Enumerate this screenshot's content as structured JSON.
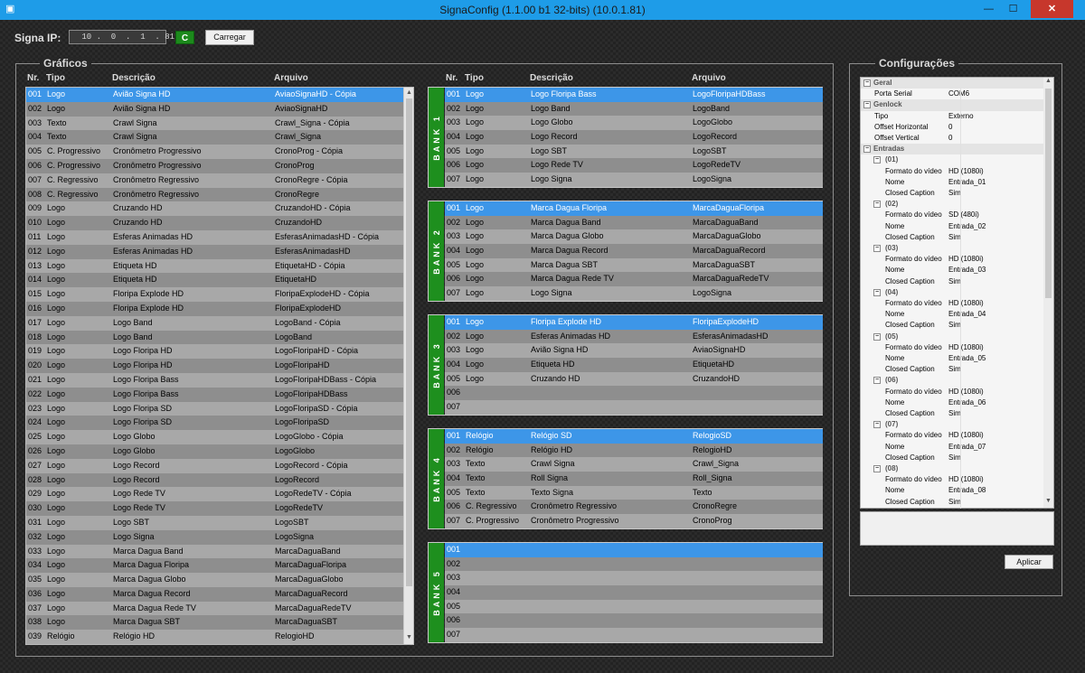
{
  "window": {
    "title": "SignaConfig (1.1.00 b1 32-bits)  (10.0.1.81)",
    "minimize_glyph": "—",
    "maximize_glyph": "☐",
    "close_glyph": "✕"
  },
  "toolbar": {
    "ip_label": "Signa IP:",
    "ip_value": " 10 .  0  .  1  . 81",
    "connect_label": "C",
    "load_label": "Carregar"
  },
  "graphics": {
    "title": "Gráficos",
    "headers": {
      "nr": "Nr.",
      "tipo": "Tipo",
      "descricao": "Descrição",
      "arquivo": "Arquivo"
    },
    "rows": [
      {
        "nr": "001",
        "tipo": "Logo",
        "desc": "Avião Signa HD",
        "file": "AviaoSignaHD - Cópia"
      },
      {
        "nr": "002",
        "tipo": "Logo",
        "desc": "Avião Signa HD",
        "file": "AviaoSignaHD"
      },
      {
        "nr": "003",
        "tipo": "Texto",
        "desc": "Crawl Signa",
        "file": "Crawl_Signa - Cópia"
      },
      {
        "nr": "004",
        "tipo": "Texto",
        "desc": "Crawl Signa",
        "file": "Crawl_Signa"
      },
      {
        "nr": "005",
        "tipo": "C. Progressivo",
        "desc": "Cronômetro Progressivo",
        "file": "CronoProg - Cópia"
      },
      {
        "nr": "006",
        "tipo": "C. Progressivo",
        "desc": "Cronômetro Progressivo",
        "file": "CronoProg"
      },
      {
        "nr": "007",
        "tipo": "C. Regressivo",
        "desc": "Cronômetro Regressivo",
        "file": "CronoRegre - Cópia"
      },
      {
        "nr": "008",
        "tipo": "C. Regressivo",
        "desc": "Cronômetro Regressivo",
        "file": "CronoRegre"
      },
      {
        "nr": "009",
        "tipo": "Logo",
        "desc": "Cruzando HD",
        "file": "CruzandoHD - Cópia"
      },
      {
        "nr": "010",
        "tipo": "Logo",
        "desc": "Cruzando HD",
        "file": "CruzandoHD"
      },
      {
        "nr": "011",
        "tipo": "Logo",
        "desc": "Esferas Animadas HD",
        "file": "EsferasAnimadasHD - Cópia"
      },
      {
        "nr": "012",
        "tipo": "Logo",
        "desc": "Esferas Animadas HD",
        "file": "EsferasAnimadasHD"
      },
      {
        "nr": "013",
        "tipo": "Logo",
        "desc": "Etiqueta HD",
        "file": "EtiquetaHD - Cópia"
      },
      {
        "nr": "014",
        "tipo": "Logo",
        "desc": "Etiqueta HD",
        "file": "EtiquetaHD"
      },
      {
        "nr": "015",
        "tipo": "Logo",
        "desc": "Floripa Explode HD",
        "file": "FloripaExplodeHD - Cópia"
      },
      {
        "nr": "016",
        "tipo": "Logo",
        "desc": "Floripa Explode HD",
        "file": "FloripaExplodeHD"
      },
      {
        "nr": "017",
        "tipo": "Logo",
        "desc": "Logo Band",
        "file": "LogoBand - Cópia"
      },
      {
        "nr": "018",
        "tipo": "Logo",
        "desc": "Logo Band",
        "file": "LogoBand"
      },
      {
        "nr": "019",
        "tipo": "Logo",
        "desc": "Logo Floripa HD",
        "file": "LogoFloripaHD - Cópia"
      },
      {
        "nr": "020",
        "tipo": "Logo",
        "desc": "Logo Floripa HD",
        "file": "LogoFloripaHD"
      },
      {
        "nr": "021",
        "tipo": "Logo",
        "desc": "Logo Floripa Bass",
        "file": "LogoFloripaHDBass - Cópia"
      },
      {
        "nr": "022",
        "tipo": "Logo",
        "desc": "Logo Floripa Bass",
        "file": "LogoFloripaHDBass"
      },
      {
        "nr": "023",
        "tipo": "Logo",
        "desc": "Logo Floripa SD",
        "file": "LogoFloripaSD - Cópia"
      },
      {
        "nr": "024",
        "tipo": "Logo",
        "desc": "Logo Floripa SD",
        "file": "LogoFloripaSD"
      },
      {
        "nr": "025",
        "tipo": "Logo",
        "desc": "Logo Globo",
        "file": "LogoGlobo - Cópia"
      },
      {
        "nr": "026",
        "tipo": "Logo",
        "desc": "Logo Globo",
        "file": "LogoGlobo"
      },
      {
        "nr": "027",
        "tipo": "Logo",
        "desc": "Logo Record",
        "file": "LogoRecord - Cópia"
      },
      {
        "nr": "028",
        "tipo": "Logo",
        "desc": "Logo Record",
        "file": "LogoRecord"
      },
      {
        "nr": "029",
        "tipo": "Logo",
        "desc": "Logo Rede TV",
        "file": "LogoRedeTV - Cópia"
      },
      {
        "nr": "030",
        "tipo": "Logo",
        "desc": "Logo Rede TV",
        "file": "LogoRedeTV"
      },
      {
        "nr": "031",
        "tipo": "Logo",
        "desc": "Logo SBT",
        "file": "LogoSBT"
      },
      {
        "nr": "032",
        "tipo": "Logo",
        "desc": "Logo Signa",
        "file": "LogoSigna"
      },
      {
        "nr": "033",
        "tipo": "Logo",
        "desc": "Marca Dagua Band",
        "file": "MarcaDaguaBand"
      },
      {
        "nr": "034",
        "tipo": "Logo",
        "desc": "Marca Dagua Floripa",
        "file": "MarcaDaguaFloripa"
      },
      {
        "nr": "035",
        "tipo": "Logo",
        "desc": "Marca Dagua Globo",
        "file": "MarcaDaguaGlobo"
      },
      {
        "nr": "036",
        "tipo": "Logo",
        "desc": "Marca Dagua Record",
        "file": "MarcaDaguaRecord"
      },
      {
        "nr": "037",
        "tipo": "Logo",
        "desc": "Marca Dagua Rede TV",
        "file": "MarcaDaguaRedeTV"
      },
      {
        "nr": "038",
        "tipo": "Logo",
        "desc": "Marca Dagua SBT",
        "file": "MarcaDaguaSBT"
      },
      {
        "nr": "039",
        "tipo": "Relógio",
        "desc": "Relógio HD",
        "file": "RelogioHD"
      }
    ]
  },
  "banks": {
    "headers": {
      "nr": "Nr.",
      "tipo": "Tipo",
      "descricao": "Descrição",
      "arquivo": "Arquivo"
    },
    "items": [
      {
        "label": "BANK 1",
        "rows": [
          {
            "nr": "001",
            "tipo": "Logo",
            "desc": "Logo Floripa Bass",
            "file": "LogoFloripaHDBass"
          },
          {
            "nr": "002",
            "tipo": "Logo",
            "desc": "Logo Band",
            "file": "LogoBand"
          },
          {
            "nr": "003",
            "tipo": "Logo",
            "desc": "Logo Globo",
            "file": "LogoGlobo"
          },
          {
            "nr": "004",
            "tipo": "Logo",
            "desc": "Logo Record",
            "file": "LogoRecord"
          },
          {
            "nr": "005",
            "tipo": "Logo",
            "desc": "Logo SBT",
            "file": "LogoSBT"
          },
          {
            "nr": "006",
            "tipo": "Logo",
            "desc": "Logo Rede TV",
            "file": "LogoRedeTV"
          },
          {
            "nr": "007",
            "tipo": "Logo",
            "desc": "Logo Signa",
            "file": "LogoSigna"
          }
        ]
      },
      {
        "label": "BANK 2",
        "rows": [
          {
            "nr": "001",
            "tipo": "Logo",
            "desc": "Marca Dagua Floripa",
            "file": "MarcaDaguaFloripa"
          },
          {
            "nr": "002",
            "tipo": "Logo",
            "desc": "Marca Dagua Band",
            "file": "MarcaDaguaBand"
          },
          {
            "nr": "003",
            "tipo": "Logo",
            "desc": "Marca Dagua Globo",
            "file": "MarcaDaguaGlobo"
          },
          {
            "nr": "004",
            "tipo": "Logo",
            "desc": "Marca Dagua Record",
            "file": "MarcaDaguaRecord"
          },
          {
            "nr": "005",
            "tipo": "Logo",
            "desc": "Marca Dagua SBT",
            "file": "MarcaDaguaSBT"
          },
          {
            "nr": "006",
            "tipo": "Logo",
            "desc": "Marca Dagua Rede TV",
            "file": "MarcaDaguaRedeTV"
          },
          {
            "nr": "007",
            "tipo": "Logo",
            "desc": "Logo Signa",
            "file": "LogoSigna"
          }
        ]
      },
      {
        "label": "BANK 3",
        "rows": [
          {
            "nr": "001",
            "tipo": "Logo",
            "desc": "Floripa Explode HD",
            "file": "FloripaExplodeHD"
          },
          {
            "nr": "002",
            "tipo": "Logo",
            "desc": "Esferas Animadas HD",
            "file": "EsferasAnimadasHD"
          },
          {
            "nr": "003",
            "tipo": "Logo",
            "desc": "Avião Signa HD",
            "file": "AviaoSignaHD"
          },
          {
            "nr": "004",
            "tipo": "Logo",
            "desc": "Etiqueta HD",
            "file": "EtiquetaHD"
          },
          {
            "nr": "005",
            "tipo": "Logo",
            "desc": "Cruzando HD",
            "file": "CruzandoHD"
          },
          {
            "nr": "006",
            "tipo": "",
            "desc": "",
            "file": ""
          },
          {
            "nr": "007",
            "tipo": "",
            "desc": "",
            "file": ""
          }
        ]
      },
      {
        "label": "BANK 4",
        "rows": [
          {
            "nr": "001",
            "tipo": "Relógio",
            "desc": "Relógio SD",
            "file": "RelogioSD"
          },
          {
            "nr": "002",
            "tipo": "Relógio",
            "desc": "Relógio HD",
            "file": "RelogioHD"
          },
          {
            "nr": "003",
            "tipo": "Texto",
            "desc": "Crawl Signa",
            "file": "Crawl_Signa"
          },
          {
            "nr": "004",
            "tipo": "Texto",
            "desc": "Roll Signa",
            "file": "Roll_Signa"
          },
          {
            "nr": "005",
            "tipo": "Texto",
            "desc": "Texto Signa",
            "file": "Texto"
          },
          {
            "nr": "006",
            "tipo": "C. Regressivo",
            "desc": "Cronômetro Regressivo",
            "file": "CronoRegre"
          },
          {
            "nr": "007",
            "tipo": "C. Progressivo",
            "desc": "Cronômetro Progressivo",
            "file": "CronoProg"
          }
        ]
      },
      {
        "label": "BANK 5",
        "rows": [
          {
            "nr": "001",
            "tipo": "",
            "desc": "",
            "file": ""
          },
          {
            "nr": "002",
            "tipo": "",
            "desc": "",
            "file": ""
          },
          {
            "nr": "003",
            "tipo": "",
            "desc": "",
            "file": ""
          },
          {
            "nr": "004",
            "tipo": "",
            "desc": "",
            "file": ""
          },
          {
            "nr": "005",
            "tipo": "",
            "desc": "",
            "file": ""
          },
          {
            "nr": "006",
            "tipo": "",
            "desc": "",
            "file": ""
          },
          {
            "nr": "007",
            "tipo": "",
            "desc": "",
            "file": ""
          }
        ]
      }
    ]
  },
  "config": {
    "title": "Configurações",
    "apply_label": "Aplicar",
    "properties": [
      {
        "kind": "cat",
        "level": 0,
        "key": "Geral",
        "value": ""
      },
      {
        "kind": "prop",
        "level": 1,
        "key": "Porta Serial",
        "value": "COM6"
      },
      {
        "kind": "cat",
        "level": 0,
        "key": "Genlock",
        "value": ""
      },
      {
        "kind": "prop",
        "level": 1,
        "key": "Tipo",
        "value": "Externo"
      },
      {
        "kind": "prop",
        "level": 1,
        "key": "Offset Horizontal",
        "value": "0"
      },
      {
        "kind": "prop",
        "level": 1,
        "key": "Offset Vertical",
        "value": "0"
      },
      {
        "kind": "cat",
        "level": 0,
        "key": "Entradas",
        "value": ""
      },
      {
        "kind": "sub",
        "level": 1,
        "key": "(01)",
        "value": ""
      },
      {
        "kind": "prop",
        "level": 2,
        "key": "Formato do vídeo",
        "value": "HD (1080i)"
      },
      {
        "kind": "prop",
        "level": 2,
        "key": "Nome",
        "value": "Entrada_01"
      },
      {
        "kind": "prop",
        "level": 2,
        "key": "Closed Caption",
        "value": "Sim"
      },
      {
        "kind": "sub",
        "level": 1,
        "key": "(02)",
        "value": ""
      },
      {
        "kind": "prop",
        "level": 2,
        "key": "Formato do vídeo",
        "value": "SD (480i)"
      },
      {
        "kind": "prop",
        "level": 2,
        "key": "Nome",
        "value": "Entrada_02"
      },
      {
        "kind": "prop",
        "level": 2,
        "key": "Closed Caption",
        "value": "Sim"
      },
      {
        "kind": "sub",
        "level": 1,
        "key": "(03)",
        "value": ""
      },
      {
        "kind": "prop",
        "level": 2,
        "key": "Formato do vídeo",
        "value": "HD (1080i)"
      },
      {
        "kind": "prop",
        "level": 2,
        "key": "Nome",
        "value": "Entrada_03"
      },
      {
        "kind": "prop",
        "level": 2,
        "key": "Closed Caption",
        "value": "Sim"
      },
      {
        "kind": "sub",
        "level": 1,
        "key": "(04)",
        "value": ""
      },
      {
        "kind": "prop",
        "level": 2,
        "key": "Formato do vídeo",
        "value": "HD (1080i)"
      },
      {
        "kind": "prop",
        "level": 2,
        "key": "Nome",
        "value": "Entrada_04"
      },
      {
        "kind": "prop",
        "level": 2,
        "key": "Closed Caption",
        "value": "Sim"
      },
      {
        "kind": "sub",
        "level": 1,
        "key": "(05)",
        "value": ""
      },
      {
        "kind": "prop",
        "level": 2,
        "key": "Formato do vídeo",
        "value": "HD (1080i)"
      },
      {
        "kind": "prop",
        "level": 2,
        "key": "Nome",
        "value": "Entrada_05"
      },
      {
        "kind": "prop",
        "level": 2,
        "key": "Closed Caption",
        "value": "Sim"
      },
      {
        "kind": "sub",
        "level": 1,
        "key": "(06)",
        "value": ""
      },
      {
        "kind": "prop",
        "level": 2,
        "key": "Formato do vídeo",
        "value": "HD (1080i)"
      },
      {
        "kind": "prop",
        "level": 2,
        "key": "Nome",
        "value": "Entrada_06"
      },
      {
        "kind": "prop",
        "level": 2,
        "key": "Closed Caption",
        "value": "Sim"
      },
      {
        "kind": "sub",
        "level": 1,
        "key": "(07)",
        "value": ""
      },
      {
        "kind": "prop",
        "level": 2,
        "key": "Formato do vídeo",
        "value": "HD (1080i)"
      },
      {
        "kind": "prop",
        "level": 2,
        "key": "Nome",
        "value": "Entrada_07"
      },
      {
        "kind": "prop",
        "level": 2,
        "key": "Closed Caption",
        "value": "Sim"
      },
      {
        "kind": "sub",
        "level": 1,
        "key": "(08)",
        "value": ""
      },
      {
        "kind": "prop",
        "level": 2,
        "key": "Formato do vídeo",
        "value": "HD (1080i)"
      },
      {
        "kind": "prop",
        "level": 2,
        "key": "Nome",
        "value": "Entrada_08"
      },
      {
        "kind": "prop",
        "level": 2,
        "key": "Closed Caption",
        "value": "Sim"
      }
    ]
  },
  "colors": {
    "title_bar": "#1e9ce8",
    "selection": "#3d96e8",
    "bank_tab": "#1e8f1e",
    "connect_button": "#1c8a1c",
    "close_button": "#c7372c"
  },
  "icons": {
    "app": "app-icon",
    "expand": "minus-box-icon",
    "scroll_up": "chevron-up-icon",
    "scroll_down": "chevron-down-icon"
  }
}
